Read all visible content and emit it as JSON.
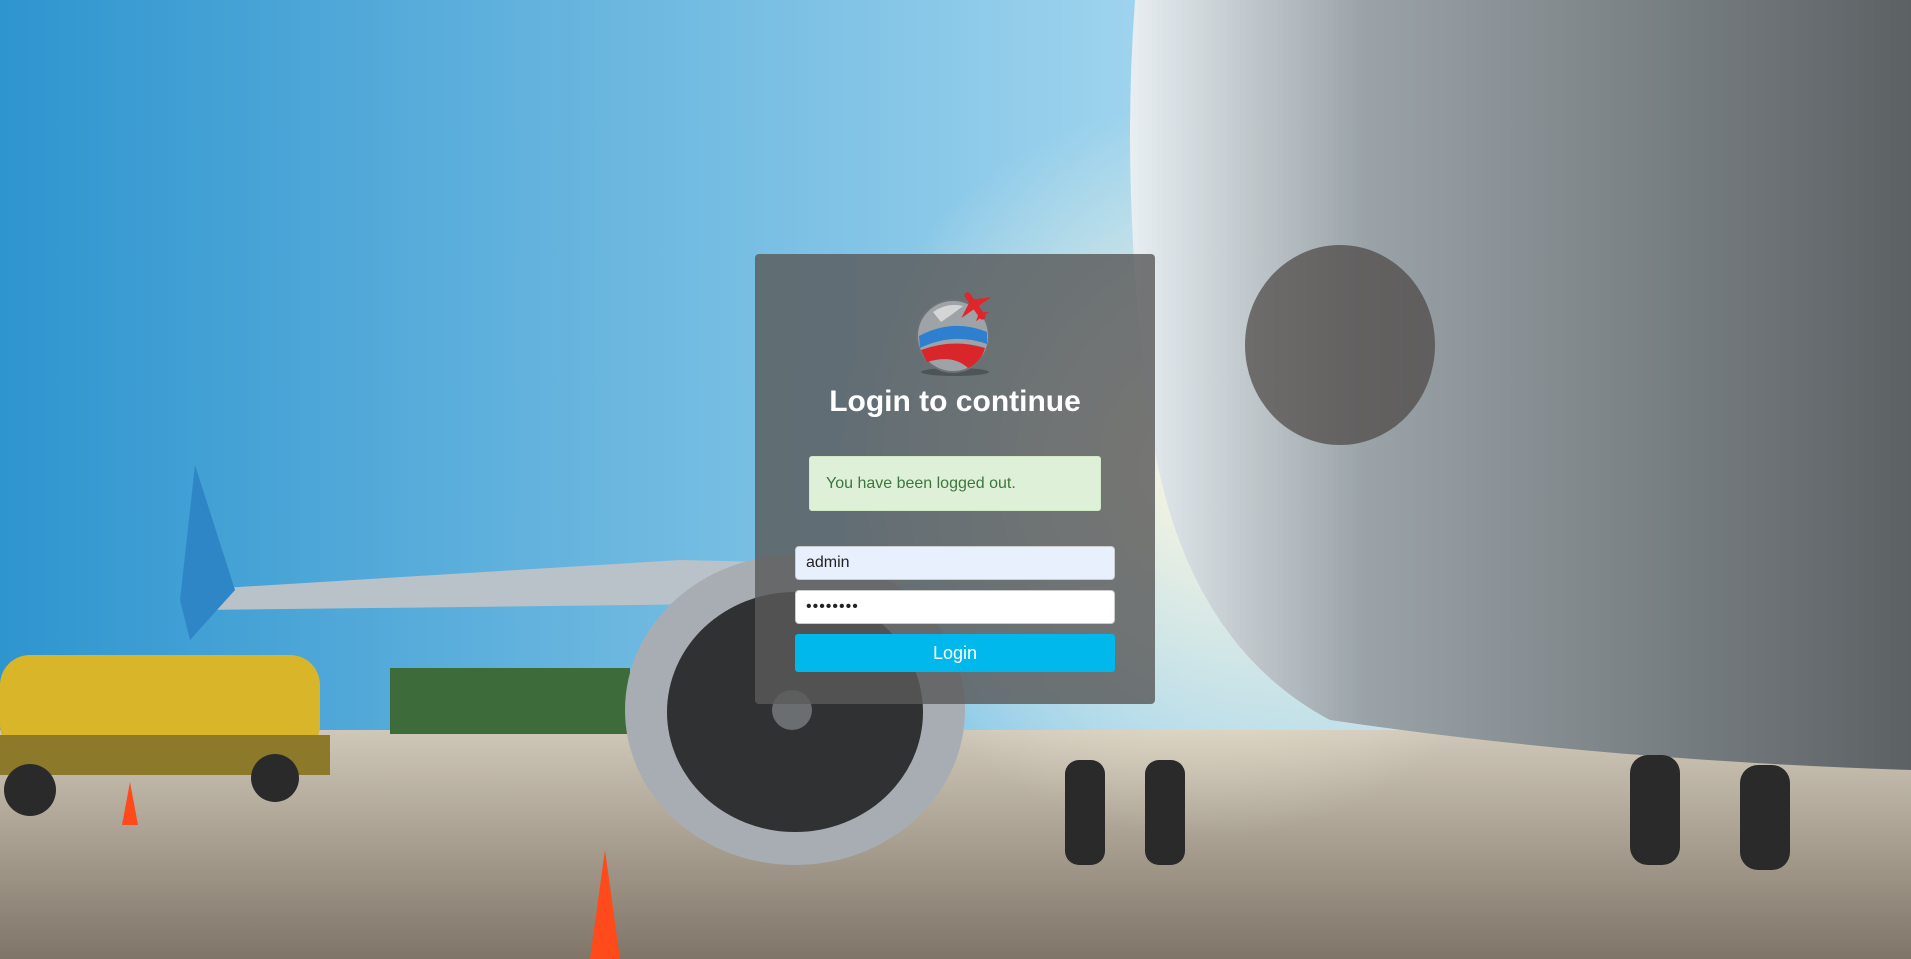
{
  "page": {
    "title": "Login to continue"
  },
  "alert": {
    "message": "You have been logged out."
  },
  "form": {
    "username_value": "admin",
    "password_value": "********",
    "login_label": "Login"
  },
  "icons": {
    "logo": "globe-with-airplane-logo"
  },
  "colors": {
    "card_bg": "#5a5a5a",
    "alert_bg": "#dff0d8",
    "alert_text": "#3c763d",
    "button_bg": "#00b8ec",
    "username_bg": "#e8f0fe"
  }
}
